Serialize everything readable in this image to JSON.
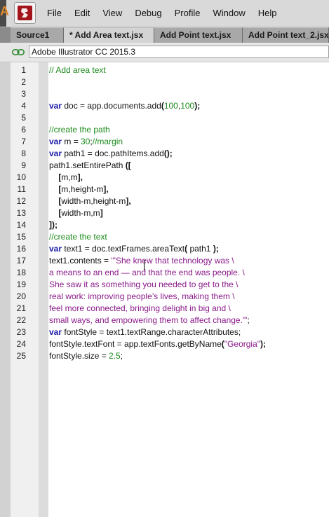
{
  "app": {
    "partial_title_letter": "A"
  },
  "menu": {
    "items": [
      "File",
      "Edit",
      "View",
      "Debug",
      "Profile",
      "Window",
      "Help"
    ]
  },
  "tabs": [
    {
      "label": "Source1",
      "active": false
    },
    {
      "label": "* Add Area text.jsx",
      "active": true
    },
    {
      "label": "Add Point text.jsx",
      "active": false
    },
    {
      "label": "Add Point text_2.jsx",
      "active": false
    }
  ],
  "target": {
    "value": "Adobe Illustrator CC 2015.3"
  },
  "colors": {
    "keyword": "#1a1aa6",
    "comment": "#1c8a1c",
    "number": "#1c8a1c",
    "string": "#8a1a8a",
    "logo": "#a3141b"
  },
  "editor": {
    "lines": [
      {
        "num": "1",
        "tokens": [
          {
            "t": "// Add area text",
            "c": "cm"
          }
        ]
      },
      {
        "num": "2",
        "tokens": []
      },
      {
        "num": "3",
        "tokens": []
      },
      {
        "num": "4",
        "tokens": [
          {
            "t": "var",
            "c": "kw"
          },
          {
            "t": " doc = app.documents.add",
            "c": ""
          },
          {
            "t": "(",
            "c": "pn"
          },
          {
            "t": "100",
            "c": "nm"
          },
          {
            "t": ",",
            "c": ""
          },
          {
            "t": "100",
            "c": "nm"
          },
          {
            "t": ");",
            "c": "pn"
          }
        ]
      },
      {
        "num": "5",
        "tokens": []
      },
      {
        "num": "6",
        "tokens": [
          {
            "t": "//create the path",
            "c": "cm"
          }
        ]
      },
      {
        "num": "7",
        "tokens": [
          {
            "t": "var",
            "c": "kw"
          },
          {
            "t": " m = ",
            "c": ""
          },
          {
            "t": "30",
            "c": "nm"
          },
          {
            "t": ";",
            "c": ""
          },
          {
            "t": "//margin",
            "c": "cm"
          }
        ]
      },
      {
        "num": "8",
        "tokens": [
          {
            "t": "var",
            "c": "kw"
          },
          {
            "t": " path1 = doc.pathItems.add",
            "c": ""
          },
          {
            "t": "();",
            "c": "pn"
          }
        ]
      },
      {
        "num": "9",
        "tokens": [
          {
            "t": "path1.setEntirePath ",
            "c": ""
          },
          {
            "t": "([",
            "c": "pn"
          }
        ]
      },
      {
        "num": "10",
        "tokens": [
          {
            "t": "    ",
            "c": ""
          },
          {
            "t": "[",
            "c": "pn"
          },
          {
            "t": "m,m",
            "c": ""
          },
          {
            "t": "],",
            "c": "pn"
          }
        ]
      },
      {
        "num": "11",
        "tokens": [
          {
            "t": "    ",
            "c": ""
          },
          {
            "t": "[",
            "c": "pn"
          },
          {
            "t": "m,height-m",
            "c": ""
          },
          {
            "t": "],",
            "c": "pn"
          }
        ]
      },
      {
        "num": "12",
        "tokens": [
          {
            "t": "    ",
            "c": ""
          },
          {
            "t": "[",
            "c": "pn"
          },
          {
            "t": "width-m,height-m",
            "c": ""
          },
          {
            "t": "],",
            "c": "pn"
          }
        ]
      },
      {
        "num": "13",
        "tokens": [
          {
            "t": "    ",
            "c": ""
          },
          {
            "t": "[",
            "c": "pn"
          },
          {
            "t": "width-m,m",
            "c": ""
          },
          {
            "t": "]",
            "c": "pn"
          }
        ]
      },
      {
        "num": "14",
        "tokens": [
          {
            "t": "]);",
            "c": "pn"
          }
        ]
      },
      {
        "num": "15",
        "tokens": [
          {
            "t": "//create the text",
            "c": "cm"
          }
        ]
      },
      {
        "num": "16",
        "tokens": [
          {
            "t": "var",
            "c": "kw"
          },
          {
            "t": " text1 = doc.textFrames.areaText",
            "c": ""
          },
          {
            "t": "(",
            "c": "pn"
          },
          {
            "t": " path1 ",
            "c": ""
          },
          {
            "t": ");",
            "c": "pn"
          }
        ]
      },
      {
        "num": "17",
        "tokens": [
          {
            "t": "text1.contents = ",
            "c": ""
          },
          {
            "t": "'\"She knew that technology was \\",
            "c": "st"
          }
        ]
      },
      {
        "num": "18",
        "tokens": [
          {
            "t": "a means to an end — and that the end was people. \\",
            "c": "st"
          }
        ]
      },
      {
        "num": "19",
        "tokens": [
          {
            "t": "She saw it as something you needed to get to the \\",
            "c": "st"
          }
        ]
      },
      {
        "num": "20",
        "tokens": [
          {
            "t": "real work: improving people’s lives, making them \\",
            "c": "st"
          }
        ]
      },
      {
        "num": "21",
        "tokens": [
          {
            "t": "feel more connected, bringing delight in big and \\",
            "c": "st"
          }
        ]
      },
      {
        "num": "22",
        "tokens": [
          {
            "t": "small ways, and empowering them to affect change.\"'",
            "c": "st"
          },
          {
            "t": ";",
            "c": ""
          }
        ]
      },
      {
        "num": "23",
        "tokens": [
          {
            "t": "var",
            "c": "kw"
          },
          {
            "t": " fontStyle = text1.textRange.characterAttributes;",
            "c": ""
          }
        ]
      },
      {
        "num": "24",
        "tokens": [
          {
            "t": "fontStyle.textFont = app.textFonts.getByName",
            "c": ""
          },
          {
            "t": "(",
            "c": "pn"
          },
          {
            "t": "\"Georgia\"",
            "c": "st"
          },
          {
            "t": ");",
            "c": "pn"
          }
        ]
      },
      {
        "num": "25",
        "tokens": [
          {
            "t": "fontStyle.size = ",
            "c": ""
          },
          {
            "t": "2.5",
            "c": "nm"
          },
          {
            "t": ";",
            "c": ""
          }
        ]
      }
    ]
  }
}
